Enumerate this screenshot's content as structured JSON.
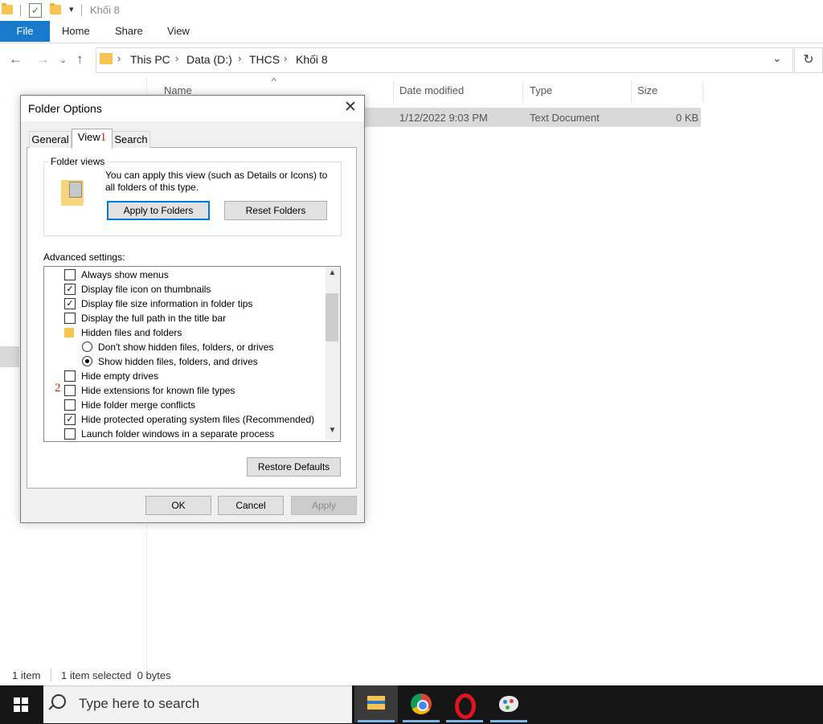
{
  "window": {
    "title": "Khối 8"
  },
  "ribbon": {
    "tabs": [
      "File",
      "Home",
      "Share",
      "View"
    ]
  },
  "address": {
    "crumbs": [
      "This PC",
      "Data (D:)",
      "THCS",
      "Khối 8"
    ]
  },
  "columns": {
    "name": "Name",
    "date": "Date modified",
    "type": "Type",
    "size": "Size"
  },
  "file_row": {
    "date": "1/12/2022 9:03 PM",
    "type": "Text Document",
    "size": "0 KB"
  },
  "status": {
    "items": "1 item",
    "selected": "1 item selected  0 bytes"
  },
  "taskbar": {
    "search_placeholder": "Type here to search"
  },
  "dialog": {
    "title": "Folder Options",
    "tabs": [
      "General",
      "View",
      "Search"
    ],
    "markers": [
      "1",
      "2"
    ],
    "folder_views": {
      "legend": "Folder views",
      "text": "You can apply this view (such as Details or Icons) to all folders of this type.",
      "apply_label": "Apply to Folders",
      "reset_label": "Reset Folders"
    },
    "advanced_label": "Advanced settings:",
    "settings": [
      {
        "label": "Always show menus",
        "kind": "checkbox",
        "checked": false
      },
      {
        "label": "Display file icon on thumbnails",
        "kind": "checkbox",
        "checked": true
      },
      {
        "label": "Display file size information in folder tips",
        "kind": "checkbox",
        "checked": true
      },
      {
        "label": "Display the full path in the title bar",
        "kind": "checkbox",
        "checked": false
      },
      {
        "label": "Hidden files and folders",
        "kind": "folder"
      },
      {
        "label": "Don't show hidden files, folders, or drives",
        "kind": "radio",
        "checked": false
      },
      {
        "label": "Show hidden files, folders, and drives",
        "kind": "radio",
        "checked": true
      },
      {
        "label": "Hide empty drives",
        "kind": "checkbox",
        "checked": false
      },
      {
        "label": "Hide extensions for known file types",
        "kind": "checkbox",
        "checked": false
      },
      {
        "label": "Hide folder merge conflicts",
        "kind": "checkbox",
        "checked": false
      },
      {
        "label": "Hide protected operating system files (Recommended)",
        "kind": "checkbox",
        "checked": true
      },
      {
        "label": "Launch folder windows in a separate process",
        "kind": "checkbox",
        "checked": false
      }
    ],
    "restore_label": "Restore Defaults",
    "ok_label": "OK",
    "cancel_label": "Cancel",
    "apply_label": "Apply"
  }
}
